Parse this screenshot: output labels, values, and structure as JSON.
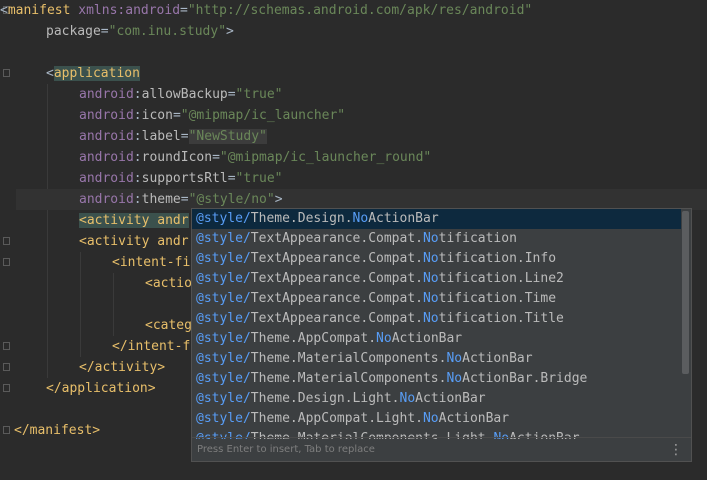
{
  "code": {
    "manifest_open_tag": "manifest",
    "xmlns_attr": "xmlns:android",
    "xmlns_value": "\"http://schemas.android.com/apk/res/android\"",
    "package_attr": "package",
    "package_value": "\"com.inu.study\"",
    "application_tag": "application",
    "ns": "android",
    "attrs": [
      {
        "name": "allowBackup",
        "value": "\"true\""
      },
      {
        "name": "icon",
        "value": "\"@mipmap/ic_launcher\""
      },
      {
        "name": "label",
        "value": "\"NewStudy\""
      },
      {
        "name": "roundIcon",
        "value": "\"@mipmap/ic_launcher_round\""
      },
      {
        "name": "supportsRtl",
        "value": "\"true\""
      },
      {
        "name": "theme",
        "value": "\"@style/no\""
      }
    ],
    "activity1_visible": "<activity andr",
    "activity2_visible": "<activity andr",
    "intent_filter_visible": "<intent-fi",
    "action_visible": "<actio",
    "category_visible": "<categ",
    "intent_filter_close_visible": "</intent-f",
    "activity_close": "</activity>",
    "application_close": "</application>",
    "manifest_close": "</manifest>"
  },
  "autocomplete": {
    "items": [
      {
        "prefix": "@style/",
        "a": "Theme.Design.",
        "m": "No",
        "b": "ActionBar"
      },
      {
        "prefix": "@style/",
        "a": "TextAppearance.Compat.",
        "m": "No",
        "b": "tification"
      },
      {
        "prefix": "@style/",
        "a": "TextAppearance.Compat.",
        "m": "No",
        "b": "tification.Info"
      },
      {
        "prefix": "@style/",
        "a": "TextAppearance.Compat.",
        "m": "No",
        "b": "tification.Line2"
      },
      {
        "prefix": "@style/",
        "a": "TextAppearance.Compat.",
        "m": "No",
        "b": "tification.Time"
      },
      {
        "prefix": "@style/",
        "a": "TextAppearance.Compat.",
        "m": "No",
        "b": "tification.Title"
      },
      {
        "prefix": "@style/",
        "a": "Theme.AppCompat.",
        "m": "No",
        "b": "ActionBar"
      },
      {
        "prefix": "@style/",
        "a": "Theme.MaterialComponents.",
        "m": "No",
        "b": "ActionBar"
      },
      {
        "prefix": "@style/",
        "a": "Theme.MaterialComponents.",
        "m": "No",
        "b": "ActionBar.Bridge"
      },
      {
        "prefix": "@style/",
        "a": "Theme.Design.Light.",
        "m": "No",
        "b": "ActionBar"
      },
      {
        "prefix": "@style/",
        "a": "Theme.AppCompat.Light.",
        "m": "No",
        "b": "ActionBar"
      },
      {
        "prefix": "@style/",
        "a": "Theme.MaterialComponents.Light.",
        "m": "No",
        "b": "ActionBar"
      }
    ],
    "footer_hint": "Press Enter to insert, Tab to replace",
    "more_icon": "⋮"
  },
  "colors": {
    "background": "#2b2b2b",
    "tag": "#e8bf6a",
    "namespace": "#9876aa",
    "string": "#6a8759",
    "match": "#589df6",
    "popup_bg": "#3c3f41",
    "selected_bg": "#0d293e"
  }
}
